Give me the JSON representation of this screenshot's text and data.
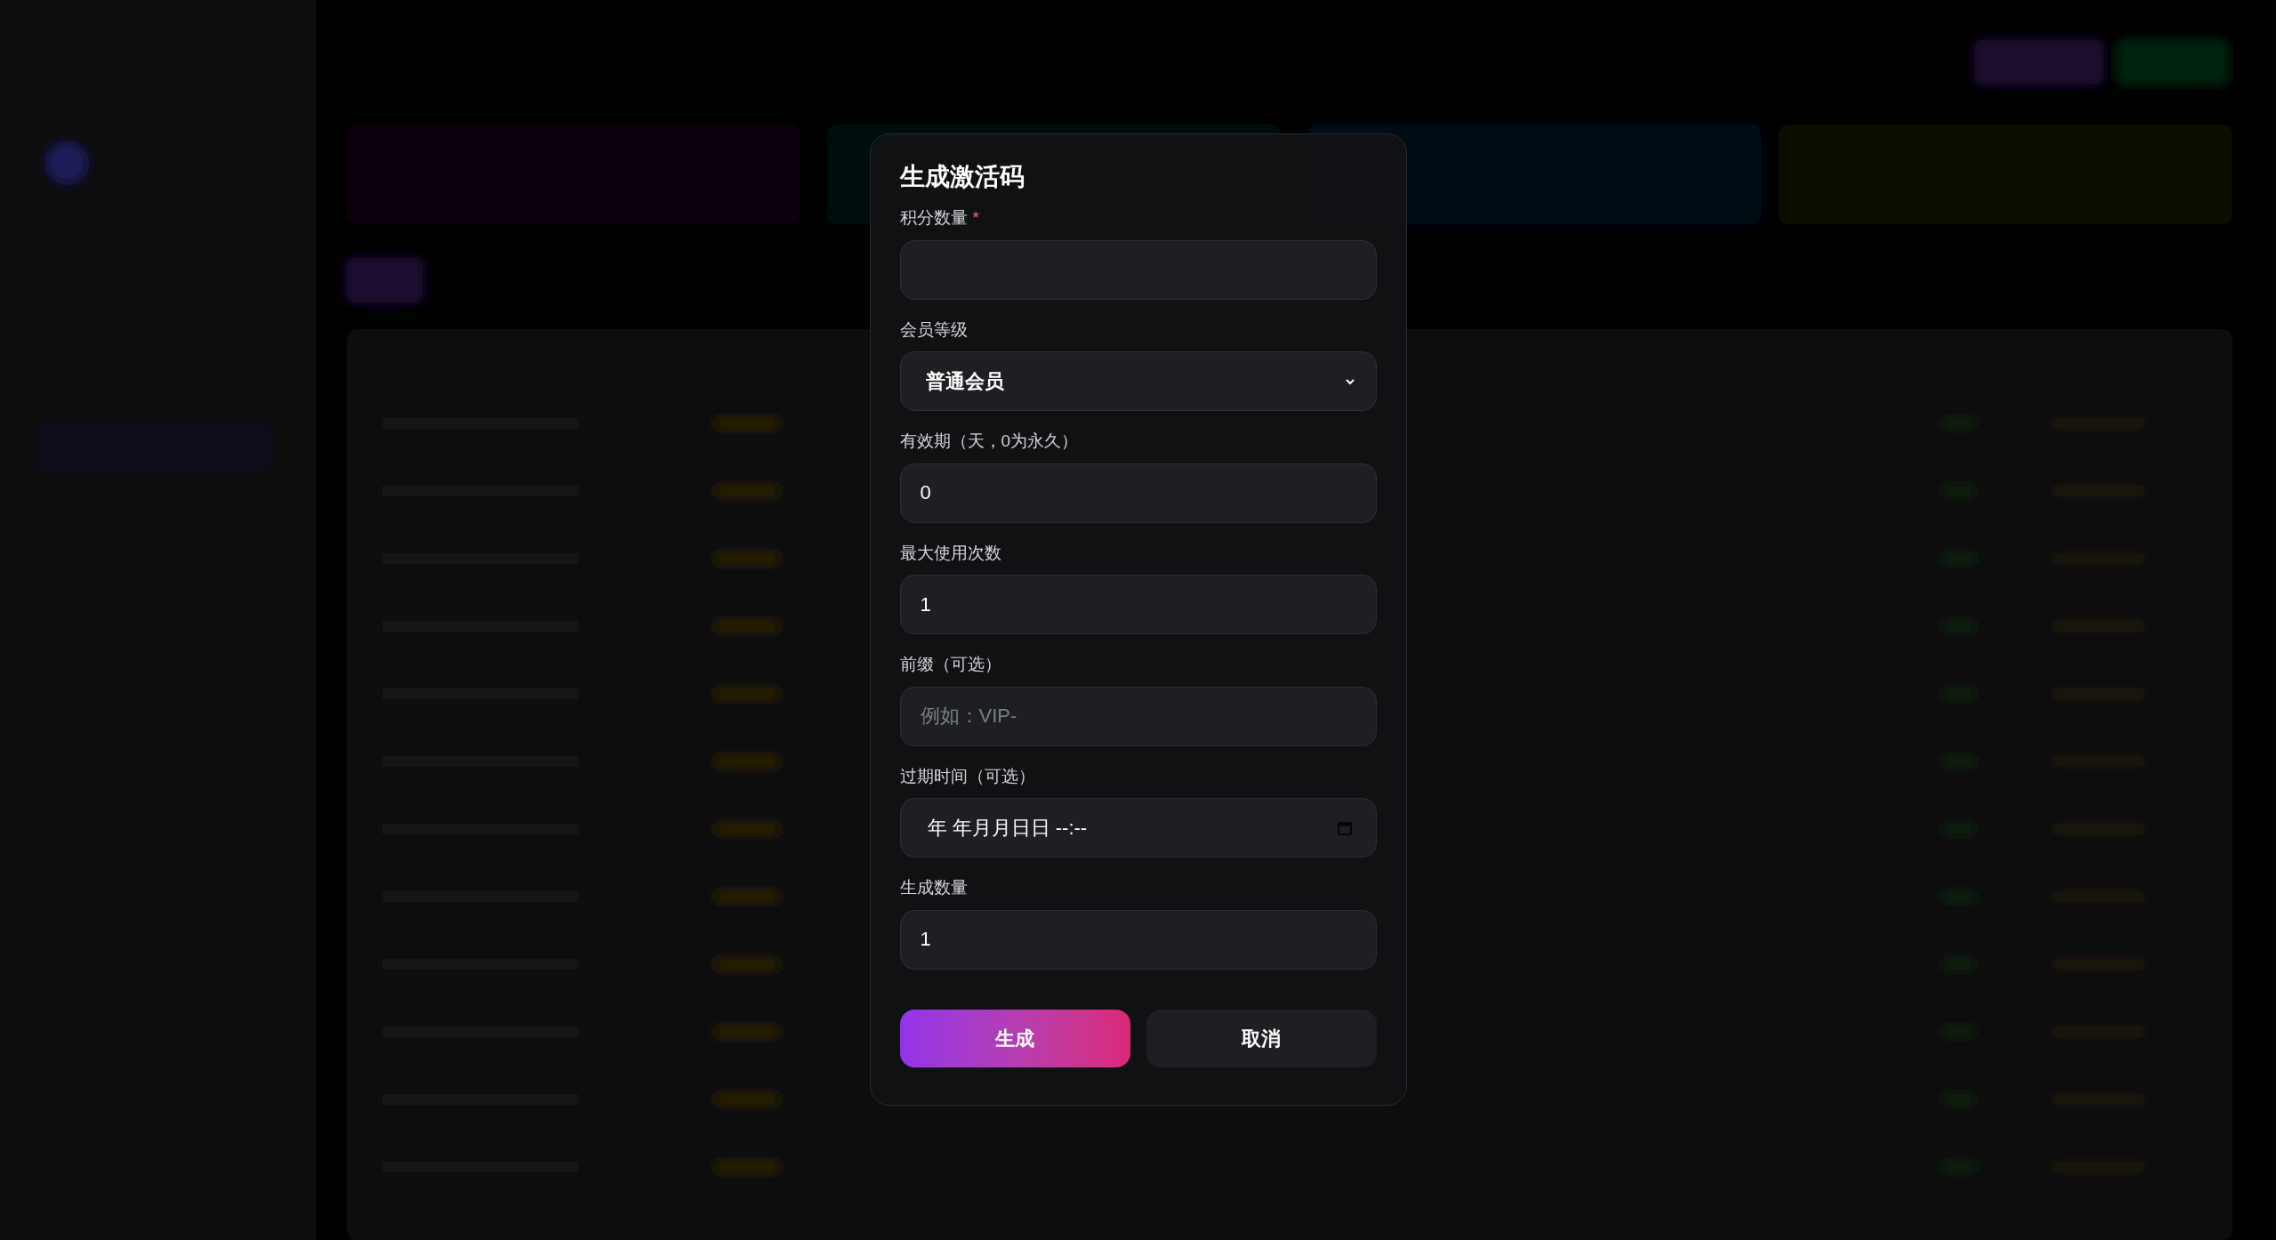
{
  "dialog": {
    "title": "生成激活码",
    "fields": [
      {
        "kind": "text",
        "label": "积分数量",
        "required_mark": "*"
      },
      {
        "kind": "select",
        "label": "会员等级",
        "value": "普通会员"
      },
      {
        "kind": "text",
        "label": "有效期（天，0为永久）",
        "value": "0"
      },
      {
        "kind": "text",
        "label": "最大使用次数",
        "value": "1"
      },
      {
        "kind": "text",
        "label": "前缀（可选）",
        "placeholder": "例如：VIP-"
      },
      {
        "kind": "datetime",
        "label": "过期时间（可选）",
        "value": "年 年月月日日 --:--"
      },
      {
        "kind": "text",
        "label": "生成数量",
        "value": "1"
      }
    ],
    "buttons": [
      {
        "kind": "primary",
        "label": "生成"
      },
      {
        "kind": "secondary",
        "label": "取消"
      }
    ]
  }
}
